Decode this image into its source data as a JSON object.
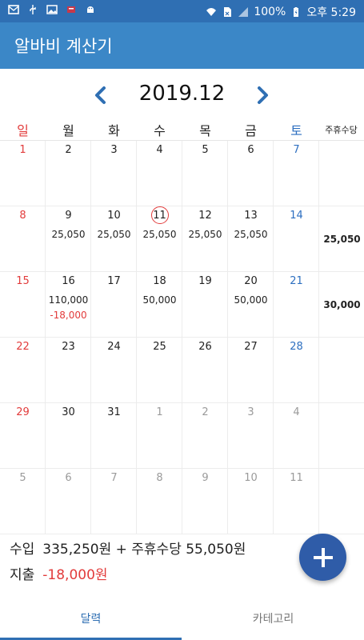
{
  "status_bar": {
    "battery": "100%",
    "time": "오후 5:29",
    "icons": [
      "mail-icon",
      "usb-icon",
      "image-icon",
      "notification-icon",
      "android-icon",
      "wifi-icon",
      "sim-icon",
      "signal-icon",
      "battery-icon"
    ]
  },
  "app": {
    "title": "알바비 계산기"
  },
  "calendar": {
    "month": "2019.12",
    "weekdays": [
      "일",
      "월",
      "화",
      "수",
      "목",
      "금",
      "토"
    ],
    "allowance_header": "주휴수당",
    "weeks": [
      {
        "days": [
          {
            "d": "1"
          },
          {
            "d": "2"
          },
          {
            "d": "3"
          },
          {
            "d": "4"
          },
          {
            "d": "5"
          },
          {
            "d": "6"
          },
          {
            "d": "7"
          }
        ],
        "allowance": ""
      },
      {
        "days": [
          {
            "d": "8"
          },
          {
            "d": "9",
            "a1": "25,050"
          },
          {
            "d": "10",
            "a1": "25,050"
          },
          {
            "d": "11",
            "a1": "25,050"
          },
          {
            "d": "12",
            "a1": "25,050"
          },
          {
            "d": "13",
            "a1": "25,050"
          },
          {
            "d": "14"
          }
        ],
        "allowance": "25,050"
      },
      {
        "days": [
          {
            "d": "15"
          },
          {
            "d": "16",
            "a1": "110,000",
            "a2": "-18,000"
          },
          {
            "d": "17"
          },
          {
            "d": "18",
            "a1": "50,000"
          },
          {
            "d": "19"
          },
          {
            "d": "20",
            "a1": "50,000"
          },
          {
            "d": "21"
          }
        ],
        "allowance": "30,000"
      },
      {
        "days": [
          {
            "d": "22"
          },
          {
            "d": "23"
          },
          {
            "d": "24"
          },
          {
            "d": "25"
          },
          {
            "d": "26"
          },
          {
            "d": "27"
          },
          {
            "d": "28"
          }
        ],
        "allowance": ""
      },
      {
        "days": [
          {
            "d": "29"
          },
          {
            "d": "30"
          },
          {
            "d": "31"
          },
          {
            "d": "1"
          },
          {
            "d": "2"
          },
          {
            "d": "3"
          },
          {
            "d": "4"
          }
        ],
        "allowance": ""
      },
      {
        "days": [
          {
            "d": "5"
          },
          {
            "d": "6"
          },
          {
            "d": "7"
          },
          {
            "d": "8"
          },
          {
            "d": "9"
          },
          {
            "d": "10"
          },
          {
            "d": "11"
          }
        ],
        "allowance": ""
      }
    ],
    "today": "11"
  },
  "summary": {
    "income_label": "수입",
    "income_value": "335,250원 + 주휴수당 55,050원",
    "expense_label": "지출",
    "expense_value": "-18,000원"
  },
  "tabs": [
    {
      "label": "달력",
      "active": true
    },
    {
      "label": "카테고리",
      "active": false
    }
  ],
  "colors": {
    "status_bar": "#2f6fb3",
    "app_bar": "#3b87c7",
    "sunday": "#e23b3b",
    "saturday": "#2d6fc0",
    "negative": "#e23b3b",
    "fab": "#2f5ca8",
    "other_month": "#9a9a9a"
  }
}
